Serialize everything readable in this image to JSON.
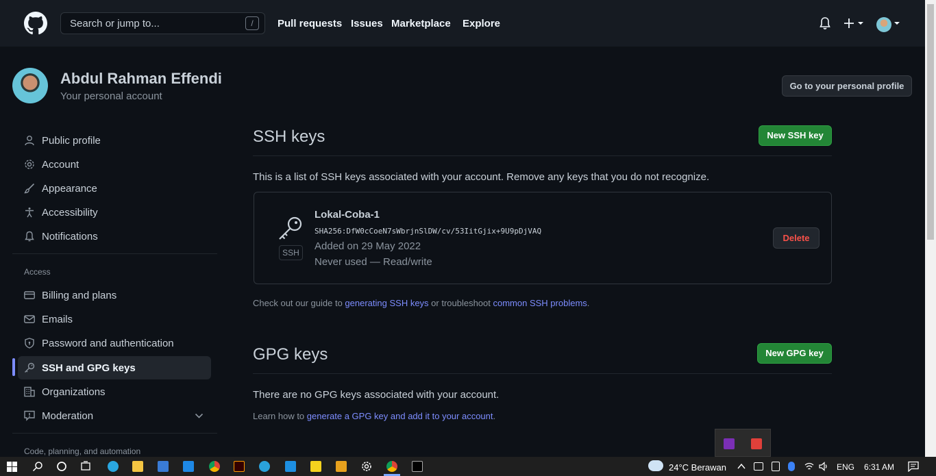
{
  "header": {
    "search_placeholder": "Search or jump to...",
    "search_shortcut": "/",
    "nav": [
      "Pull requests",
      "Issues",
      "Marketplace",
      "Explore"
    ]
  },
  "user": {
    "name": "Abdul Rahman Effendi",
    "subtitle": "Your personal account",
    "profile_button": "Go to your personal profile"
  },
  "sidebar": {
    "items": [
      {
        "label": "Public profile",
        "icon": "person-icon"
      },
      {
        "label": "Account",
        "icon": "gear-icon"
      },
      {
        "label": "Appearance",
        "icon": "paintbrush-icon"
      },
      {
        "label": "Accessibility",
        "icon": "accessibility-icon"
      },
      {
        "label": "Notifications",
        "icon": "bell-icon"
      }
    ],
    "access_heading": "Access",
    "access_items": [
      {
        "label": "Billing and plans",
        "icon": "credit-card-icon"
      },
      {
        "label": "Emails",
        "icon": "mail-icon"
      },
      {
        "label": "Password and authentication",
        "icon": "shield-icon"
      },
      {
        "label": "SSH and GPG keys",
        "icon": "key-icon",
        "active": true
      },
      {
        "label": "Organizations",
        "icon": "organization-icon"
      },
      {
        "label": "Moderation",
        "icon": "report-icon"
      }
    ],
    "code_heading": "Code, planning, and automation"
  },
  "ssh": {
    "title": "SSH keys",
    "new_button": "New SSH key",
    "intro": "This is a list of SSH keys associated with your account. Remove any keys that you do not recognize.",
    "key": {
      "badge": "SSH",
      "name": "Lokal-Coba-1",
      "fingerprint": "SHA256:DfW0cCoeN7sWbrjnSlDW/cv/53IitGjix+9U9pDjVAQ",
      "added": "Added on 29 May 2022",
      "usage": "Never used — Read/write",
      "delete_button": "Delete"
    },
    "guide_prefix": "Check out our guide to ",
    "guide_link1": "generating SSH keys",
    "guide_mid": " or troubleshoot ",
    "guide_link2": "common SSH problems",
    "guide_suffix": "."
  },
  "gpg": {
    "title": "GPG keys",
    "new_button": "New GPG key",
    "empty": "There are no GPG keys associated with your account.",
    "learn_prefix": "Learn how to ",
    "learn_link": "generate a GPG key and add it to your account",
    "learn_suffix": "."
  },
  "taskbar": {
    "weather": "24°C  Berawan",
    "language": "ENG",
    "time": "6:31 AM"
  },
  "colors": {
    "accent_green": "#238636",
    "link_blue": "#7d8dff",
    "danger_red": "#f85149",
    "background": "#0d1117"
  }
}
